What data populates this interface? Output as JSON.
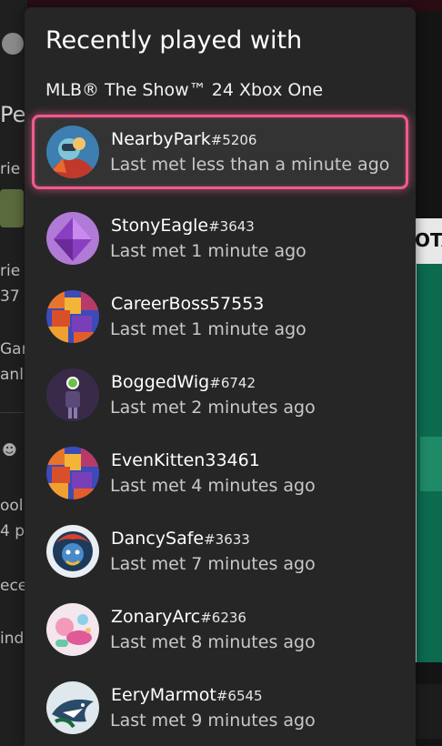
{
  "panel": {
    "title": "Recently played with",
    "game": "MLB® The Show™ 24 Xbox One"
  },
  "players": [
    {
      "gamertag": "NearbyPark",
      "suffix": "#5206",
      "last_met": "Last met less than a minute ago",
      "selected": true,
      "avatar_icon": "robot-avatar-icon"
    },
    {
      "gamertag": "StonyEagle",
      "suffix": "#3643",
      "last_met": "Last met 1 minute ago",
      "selected": false,
      "avatar_icon": "purple-gem-avatar-icon"
    },
    {
      "gamertag": "CareerBoss57553",
      "suffix": "",
      "last_met": "Last met 1 minute ago",
      "selected": false,
      "avatar_icon": "orange-mosaic-avatar-icon"
    },
    {
      "gamertag": "BoggedWig",
      "suffix": "#6742",
      "last_met": "Last met 2 minutes ago",
      "selected": false,
      "avatar_icon": "xbox-figure-avatar-icon"
    },
    {
      "gamertag": "EvenKitten33461",
      "suffix": "",
      "last_met": "Last met 4 minutes ago",
      "selected": false,
      "avatar_icon": "orange-mosaic-avatar-icon"
    },
    {
      "gamertag": "DancySafe",
      "suffix": "#3633",
      "last_met": "Last met 7 minutes ago",
      "selected": false,
      "avatar_icon": "lion-avatar-icon"
    },
    {
      "gamertag": "ZonaryArc",
      "suffix": "#6236",
      "last_met": "Last met 8 minutes ago",
      "selected": false,
      "avatar_icon": "pastel-shapes-avatar-icon"
    },
    {
      "gamertag": "EeryMarmot",
      "suffix": "#6545",
      "last_met": "Last met 9 minutes ago",
      "selected": false,
      "avatar_icon": "shark-avatar-icon"
    }
  ],
  "background": {
    "peo": "Peo",
    "texts": [
      "rie",
      "rie",
      "37",
      "Gam",
      "anl",
      "ool",
      "4 p",
      "ece",
      "ind"
    ],
    "right_label": "OTA"
  },
  "colors": {
    "panel_bg": "#262626",
    "selection_accent": "#f05a8c",
    "text_secondary": "#c8c8c8"
  }
}
